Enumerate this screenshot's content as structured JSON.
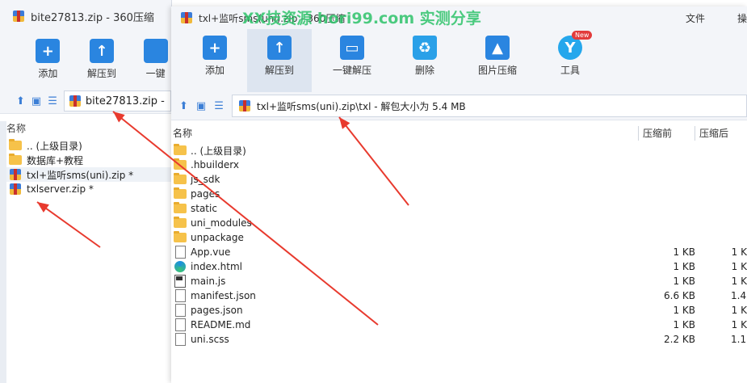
{
  "back_window": {
    "title": "bite27813.zip - 360压缩",
    "toolbar": [
      {
        "label": "添加",
        "icon": "add-icon"
      },
      {
        "label": "解压到",
        "icon": "extract-icon"
      },
      {
        "label": "一键",
        "icon": "one-click-icon"
      }
    ],
    "address": "bite27813.zip -",
    "column_name": "名称",
    "items": [
      {
        "name": ".. (上级目录)",
        "type": "folder"
      },
      {
        "name": "数据库+教程",
        "type": "folder"
      },
      {
        "name": "txl+监听sms(uni).zip *",
        "type": "zip"
      },
      {
        "name": "txlserver.zip *",
        "type": "zip"
      }
    ]
  },
  "front_window": {
    "title": "txl+监听sms(uni).zip - 360压缩",
    "menu": [
      "文件",
      "操"
    ],
    "toolbar": [
      {
        "label": "添加",
        "icon": "add-icon"
      },
      {
        "label": "解压到",
        "icon": "extract-icon"
      },
      {
        "label": "一键解压",
        "icon": "one-click-extract-icon"
      },
      {
        "label": "删除",
        "icon": "trash-icon"
      },
      {
        "label": "图片压缩",
        "icon": "image-compress-icon"
      },
      {
        "label": "工具",
        "icon": "tools-icon",
        "badge": "New"
      }
    ],
    "address": "txl+监听sms(uni).zip\\txl - 解包大小为 5.4 MB",
    "columns": {
      "name": "名称",
      "packed": "压缩前",
      "size": "压缩后"
    },
    "items": [
      {
        "name": ".. (上级目录)",
        "type": "folder",
        "packed": "",
        "size": ""
      },
      {
        "name": ".hbuilderx",
        "type": "folder",
        "packed": "",
        "size": ""
      },
      {
        "name": "js_sdk",
        "type": "folder",
        "packed": "",
        "size": ""
      },
      {
        "name": "pages",
        "type": "folder",
        "packed": "",
        "size": ""
      },
      {
        "name": "static",
        "type": "folder",
        "packed": "",
        "size": ""
      },
      {
        "name": "uni_modules",
        "type": "folder",
        "packed": "",
        "size": ""
      },
      {
        "name": "unpackage",
        "type": "folder",
        "packed": "",
        "size": ""
      },
      {
        "name": "App.vue",
        "type": "file",
        "packed": "1 KB",
        "size": "1 K"
      },
      {
        "name": "index.html",
        "type": "edge",
        "packed": "1 KB",
        "size": "1 K"
      },
      {
        "name": "main.js",
        "type": "js",
        "packed": "1 KB",
        "size": "1 K"
      },
      {
        "name": "manifest.json",
        "type": "file",
        "packed": "6.6 KB",
        "size": "1.4 K"
      },
      {
        "name": "pages.json",
        "type": "file",
        "packed": "1 KB",
        "size": "1 K"
      },
      {
        "name": "README.md",
        "type": "file",
        "packed": "1 KB",
        "size": "1 K"
      },
      {
        "name": "uni.scss",
        "type": "file",
        "packed": "2.2 KB",
        "size": "1.1 K"
      }
    ]
  },
  "watermark": "XX技资源 hori99.com 实测分享",
  "accent_color": "#2a85e0",
  "arrow_color": "#e83a2e"
}
